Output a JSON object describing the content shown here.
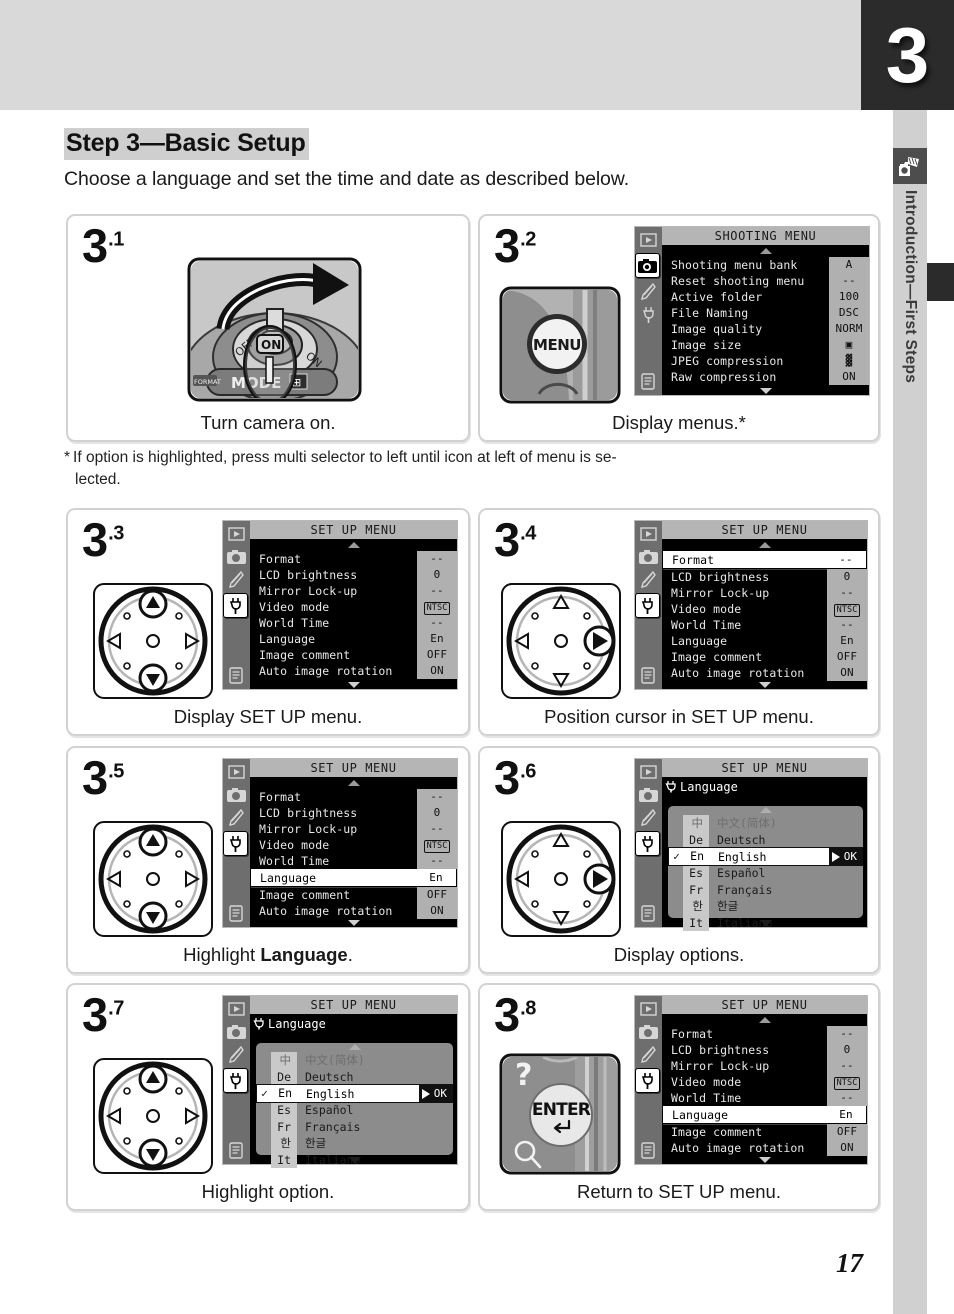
{
  "chapter_tab": "3",
  "sidebar": {
    "label": "Introduction—First Steps",
    "icon": "camera-hand-icon"
  },
  "heading": {
    "title": "Step 3—Basic Setup",
    "subtitle": "Choose a language and set the time and date as described below."
  },
  "footnote": {
    "marker": "*",
    "line1": "If option is highlighted, press multi selector to left until icon at left of menu is se-",
    "line2": "lected."
  },
  "page_number": "17",
  "menus": {
    "shooting": {
      "title": "SHOOTING MENU",
      "rows": [
        {
          "label": "Shooting menu bank",
          "value": "A"
        },
        {
          "label": "Reset shooting menu",
          "value": "--"
        },
        {
          "label": "Active folder",
          "value": "100"
        },
        {
          "label": "File Naming",
          "value": "DSC"
        },
        {
          "label": "Image quality",
          "value": "NORM"
        },
        {
          "label": "Image size",
          "value": "▣"
        },
        {
          "label": "JPEG compression",
          "value": "▓"
        },
        {
          "label": "Raw compression",
          "value": "ON"
        }
      ]
    },
    "setup": {
      "title": "SET UP MENU",
      "rows": [
        {
          "label": "Format",
          "value": "--"
        },
        {
          "label": "LCD brightness",
          "value": "0"
        },
        {
          "label": "Mirror Lock-up",
          "value": "--"
        },
        {
          "label": "Video mode",
          "value": "NTSC"
        },
        {
          "label": "World Time",
          "value": "--"
        },
        {
          "label": "Language",
          "value": "En"
        },
        {
          "label": "Image comment",
          "value": "OFF"
        },
        {
          "label": "Auto image rotation",
          "value": "ON"
        }
      ]
    },
    "language": {
      "title": "SET UP MENU",
      "sub_label": "Language",
      "options": [
        {
          "abbr": "中",
          "name": "中文(简体)",
          "checked": false
        },
        {
          "abbr": "De",
          "name": "Deutsch",
          "checked": false
        },
        {
          "abbr": "En",
          "name": "English",
          "checked": true
        },
        {
          "abbr": "Es",
          "name": "Español",
          "checked": false
        },
        {
          "abbr": "Fr",
          "name": "Français",
          "checked": false
        },
        {
          "abbr": "한",
          "name": "한글",
          "checked": false
        },
        {
          "abbr": "It",
          "name": "Italiano",
          "checked": false
        }
      ],
      "ok_label": "OK"
    }
  },
  "steps": [
    {
      "num": "3",
      "sub": ".1",
      "caption": "Turn camera on.",
      "art": "power-switch-illustration"
    },
    {
      "num": "3",
      "sub": ".2",
      "caption": "Display menus.*",
      "art": "menu-button-illustration"
    },
    {
      "num": "3",
      "sub": ".3",
      "caption": "Display SET UP menu.",
      "art": "multi-selector-updown"
    },
    {
      "num": "3",
      "sub": ".4",
      "caption": "Position cursor in SET UP menu.",
      "art": "multi-selector-right"
    },
    {
      "num": "3",
      "sub": ".5",
      "caption_prefix": "Highlight ",
      "caption_bold": "Language",
      "caption_suffix": ".",
      "art": "multi-selector-updown"
    },
    {
      "num": "3",
      "sub": ".6",
      "caption": "Display options.",
      "art": "multi-selector-right"
    },
    {
      "num": "3",
      "sub": ".7",
      "caption": "Highlight option.",
      "art": "multi-selector-updown"
    },
    {
      "num": "3",
      "sub": ".8",
      "caption": "Return to SET UP menu.",
      "art": "enter-button-illustration"
    }
  ],
  "illustration_labels": {
    "menu_button": "MENU",
    "enter_button": "ENTER",
    "power_on": "ON",
    "mode_label": "MODE",
    "format_label": "FORMAT",
    "help_glyph": "?",
    "zoom_glyph": "⚲"
  },
  "colors": {
    "chapter_tab_bg": "#2b2b2b",
    "band_bg": "#d9d9d9",
    "rail_bg": "#d0d0d0",
    "panel_border": "#d2d2d2",
    "lcd_title_bg": "#b5b5b5",
    "lcd_value_bg": "#b0b0b0",
    "option_panel_bg": "#8c8c8c"
  }
}
